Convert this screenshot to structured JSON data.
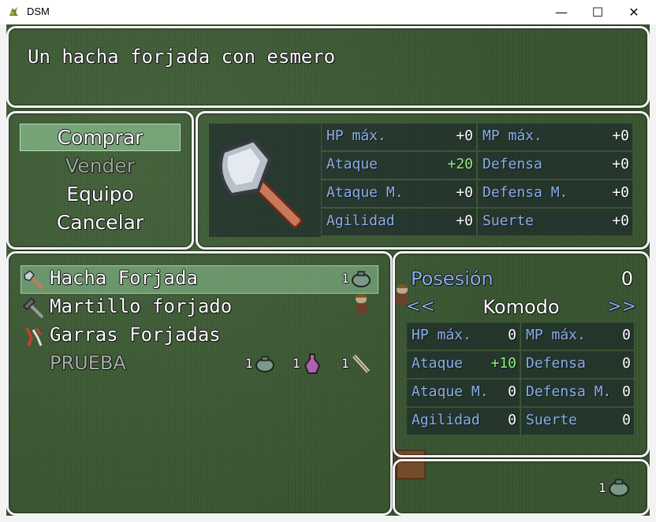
{
  "window": {
    "title": "DSM",
    "minimize": "—",
    "maximize": "☐",
    "close": "✕"
  },
  "help": {
    "text": "Un hacha forjada con esmero"
  },
  "commands": [
    {
      "label": "Comprar",
      "selected": true,
      "enabled": true
    },
    {
      "label": "Vender",
      "selected": false,
      "enabled": false
    },
    {
      "label": "Equipo",
      "selected": false,
      "enabled": true
    },
    {
      "label": "Cancelar",
      "selected": false,
      "enabled": true
    }
  ],
  "item_stats": {
    "icon": "axe-icon",
    "rows": [
      {
        "label": "HP máx.",
        "value": "+0"
      },
      {
        "label": "MP máx.",
        "value": "+0"
      },
      {
        "label": "Ataque",
        "value": "+20"
      },
      {
        "label": "Defensa",
        "value": "+0"
      },
      {
        "label": "Ataque M.",
        "value": "+0"
      },
      {
        "label": "Defensa M.",
        "value": "+0"
      },
      {
        "label": "Agilidad",
        "value": "+0"
      },
      {
        "label": "Suerte",
        "value": "+0"
      }
    ]
  },
  "shop_items": [
    {
      "name": "Hacha Forjada",
      "icon": "axe-icon",
      "costs": [
        {
          "amount": "1",
          "icon": "pot-icon"
        }
      ],
      "selected": true,
      "enabled": true
    },
    {
      "name": "Martillo forjado",
      "icon": "hammer-icon",
      "costs": [],
      "selected": false,
      "enabled": true
    },
    {
      "name": "Garras Forjadas",
      "icon": "claws-icon",
      "costs": [],
      "selected": false,
      "enabled": true
    },
    {
      "name": "PRUEBA",
      "icon": "",
      "costs": [
        {
          "amount": "1",
          "icon": "pot-icon"
        },
        {
          "amount": "1",
          "icon": "potion-icon"
        },
        {
          "amount": "1",
          "icon": "wand-icon"
        }
      ],
      "selected": false,
      "enabled": false
    }
  ],
  "status": {
    "possession_label": "Posesión",
    "possession_value": "0",
    "prev_arrow": "<<",
    "actor_name": "Komodo",
    "next_arrow": ">>",
    "rows": [
      {
        "label": "HP máx.",
        "value": "0"
      },
      {
        "label": "MP máx.",
        "value": "0"
      },
      {
        "label": "Ataque",
        "value": "+10"
      },
      {
        "label": "Defensa",
        "value": "0"
      },
      {
        "label": "Ataque M.",
        "value": "0"
      },
      {
        "label": "Defensa M.",
        "value": "0"
      },
      {
        "label": "Agilidad",
        "value": "0"
      },
      {
        "label": "Suerte",
        "value": "0"
      }
    ]
  },
  "cost": {
    "amount": "1",
    "icon": "pot-icon"
  },
  "colors": {
    "panel_border": "#f4f4f4",
    "system_blue": "#88aee8",
    "power_up": "#8cf07a",
    "background": "#3f5a36"
  }
}
